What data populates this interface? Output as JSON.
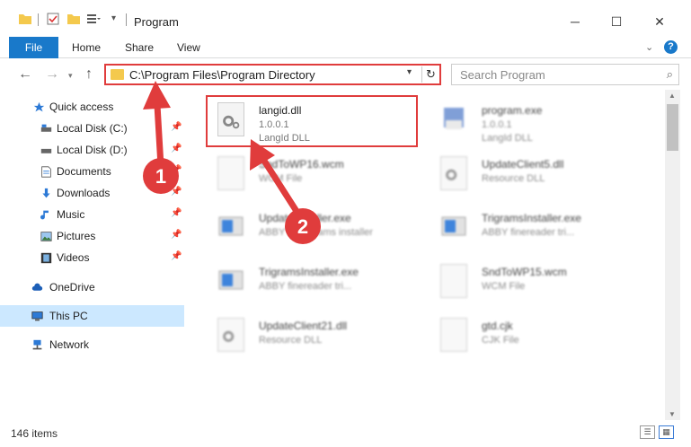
{
  "window": {
    "title": "Program"
  },
  "ribbon": {
    "file": "File",
    "home": "Home",
    "share": "Share",
    "view": "View",
    "help": "?"
  },
  "address": {
    "path": "C:\\Program Files\\Program Directory"
  },
  "search": {
    "placeholder": "Search Program"
  },
  "sidebar": {
    "items": [
      {
        "label": "Quick access",
        "icon": "star-icon"
      },
      {
        "label": "Local Disk (C:)",
        "icon": "drive-icon"
      },
      {
        "label": "Local Disk (D:)",
        "icon": "drive-icon"
      },
      {
        "label": "Documents",
        "icon": "documents-icon"
      },
      {
        "label": "Downloads",
        "icon": "download-icon"
      },
      {
        "label": "Music",
        "icon": "music-icon"
      },
      {
        "label": "Pictures",
        "icon": "pictures-icon"
      },
      {
        "label": "Videos",
        "icon": "videos-icon"
      },
      {
        "label": "OneDrive",
        "icon": "cloud-icon"
      },
      {
        "label": "This PC",
        "icon": "computer-icon"
      },
      {
        "label": "Network",
        "icon": "network-icon"
      }
    ]
  },
  "files": [
    {
      "name": "langid.dll",
      "line2": "1.0.0.1",
      "line3": "LangId DLL"
    },
    {
      "name": "program.exe",
      "line2": "1.0.0.1",
      "line3": "LangId DLL"
    },
    {
      "name": "SndToWP16.wcm",
      "line2": "WCM File"
    },
    {
      "name": "UpdateClient5.dll",
      "line2": "Resource DLL"
    },
    {
      "name": "UpdateInstaller.exe",
      "line2": "ABBYY programs installer"
    },
    {
      "name": "TrigramsInstaller.exe",
      "line2": "ABBY finereader tri..."
    },
    {
      "name": "TrigramsInstaller.exe",
      "line2": "ABBY finereader tri..."
    },
    {
      "name": "SndToWP15.wcm",
      "line2": "WCM File"
    },
    {
      "name": "UpdateClient21.dll",
      "line2": "Resource DLL"
    },
    {
      "name": "gtd.cjk",
      "line2": "CJK File"
    }
  ],
  "status": {
    "count": "146 items"
  },
  "annotations": {
    "step1": "1",
    "step2": "2"
  },
  "colors": {
    "accent": "#1979ca",
    "highlight": "#e03c3c",
    "selected": "#cce8ff"
  }
}
